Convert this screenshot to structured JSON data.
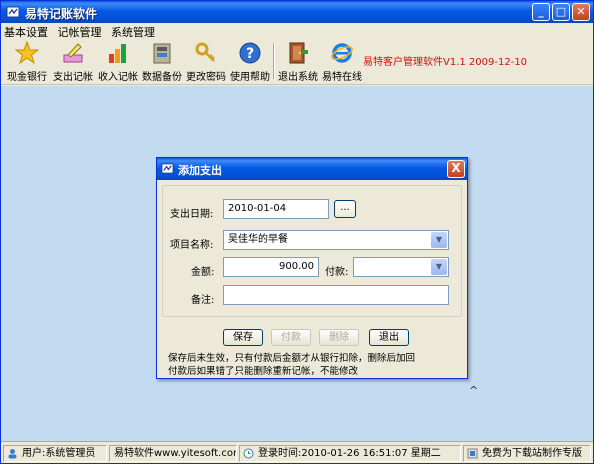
{
  "app": {
    "title": "易特记账软件",
    "version_text": "易特客户管理软件V1.1 2009-12-10"
  },
  "menu": [
    "基本设置",
    "记帐管理",
    "系统管理"
  ],
  "toolbar": [
    {
      "label": "现金银行",
      "icon": "star-icon"
    },
    {
      "label": "支出记帐",
      "icon": "pen-icon"
    },
    {
      "label": "收入记帐",
      "icon": "bar-chart-icon"
    },
    {
      "label": "数据备份",
      "icon": "database-icon"
    },
    {
      "label": "更改密码",
      "icon": "key-icon"
    },
    {
      "label": "使用帮助",
      "icon": "help-icon"
    },
    {
      "label": "退出系统",
      "icon": "exit-door-icon"
    },
    {
      "label": "易特在线",
      "icon": "ie-icon"
    }
  ],
  "dialog": {
    "title": "添加支出",
    "close_label": "X",
    "date_label": "支出日期:",
    "date_value": "2010-01-04",
    "date_button": "...",
    "item_label": "项目名称:",
    "item_value": "吴佳华的早餐",
    "amount_label": "金额:",
    "amount_value": "900.00",
    "payment_label": "付款:",
    "payment_value": "",
    "remark_label": "备注:",
    "remark_value": "",
    "buttons": {
      "save": "保存",
      "pay": "付款",
      "delete": "删除",
      "exit": "退出"
    },
    "note_line1": "保存后未生效，只有付款后金额才从银行扣除，删除后加回",
    "note_line2": "付款后如果错了只能删除重新记帐，不能修改"
  },
  "statusbar": {
    "user": "用户:系统管理员",
    "company": "易特软件www.yitesoft.com",
    "login_time": "登录时间:2010-01-26 16:51:07 星期二",
    "promo": "免费为下载站制作专版"
  },
  "colors": {
    "title_blue": "#0758e6",
    "workspace": "#c2dbf0",
    "version_red": "#d01010"
  }
}
